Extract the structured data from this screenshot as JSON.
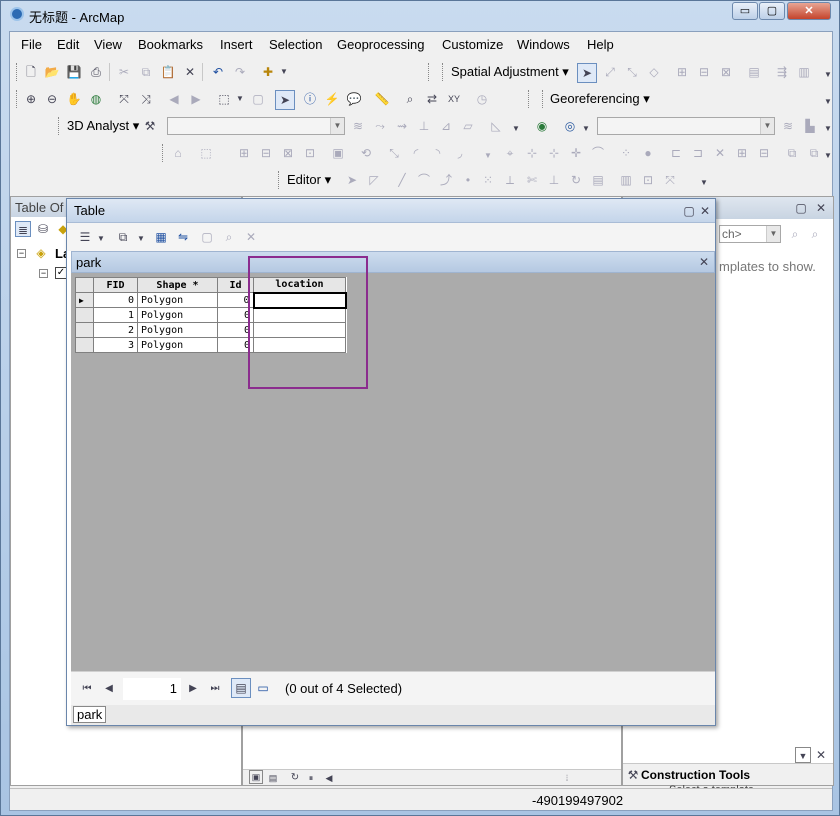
{
  "window": {
    "title": "无标题 - ArcMap",
    "min": "▭",
    "max": "▢",
    "close": "✕"
  },
  "menu": [
    "File",
    "Edit",
    "View",
    "Bookmarks",
    "Insert",
    "Selection",
    "Geoprocessing",
    "Customize",
    "Windows",
    "Help"
  ],
  "toolbars": {
    "spatial_adjustment": "Spatial Adjustment ▾",
    "georeferencing": "Georeferencing ▾",
    "analyst_3d": "3D Analyst ▾",
    "editor": "Editor ▾"
  },
  "toc": {
    "title": "Table Of",
    "layers_label": "La"
  },
  "right_pane": {
    "search_placeholder": "ch>",
    "templates_msg": "mplates to show.",
    "construction_tools": "Construction Tools",
    "select_template": "Select a template"
  },
  "status": {
    "coords": "-490199497902"
  },
  "table_window": {
    "title": "Table",
    "tab_name": "park",
    "columns": [
      "FID",
      "Shape *",
      "Id",
      "location"
    ],
    "rows": [
      {
        "fid": "0",
        "shape": "Polygon",
        "id": "0",
        "location": ""
      },
      {
        "fid": "1",
        "shape": "Polygon",
        "id": "0",
        "location": ""
      },
      {
        "fid": "2",
        "shape": "Polygon",
        "id": "0",
        "location": ""
      },
      {
        "fid": "3",
        "shape": "Polygon",
        "id": "0",
        "location": ""
      }
    ],
    "record": "1",
    "selection_text": "(0 out of 4 Selected)",
    "footer_tab": "park"
  },
  "colors": {
    "highlight": "#8b2c8e",
    "title_bar": "#c4d5ea"
  }
}
